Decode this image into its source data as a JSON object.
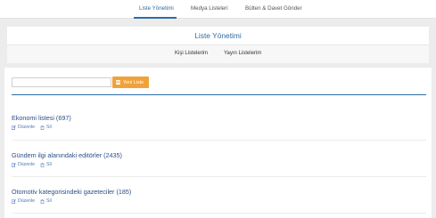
{
  "top_nav": {
    "tabs": [
      {
        "label": "Liste Yönetimi",
        "active": true
      },
      {
        "label": "Medya Listeleri",
        "active": false
      },
      {
        "label": "Bülten & Davet Gönder",
        "active": false
      }
    ]
  },
  "page_title": "Liste Yönetimi",
  "sub_tabs": [
    "Kişi Listelerim",
    "Yayın Listelerim"
  ],
  "toolbar": {
    "search_value": "",
    "new_list_label": "Yeni Liste"
  },
  "lists": [
    {
      "name": "Ekonomi listesi (697)",
      "edit_label": "Düzenle",
      "delete_label": "Sil"
    },
    {
      "name": "Gündem ilgi alanındaki editörler (2435)",
      "edit_label": "Düzenle",
      "delete_label": "Sil"
    },
    {
      "name": "Otomotiv kategorisindeki gazeteciler (185)",
      "edit_label": "Düzenle",
      "delete_label": "Sil"
    }
  ],
  "colors": {
    "accent": "#2e6da4",
    "button": "#f0a23a",
    "background": "#ececec"
  }
}
